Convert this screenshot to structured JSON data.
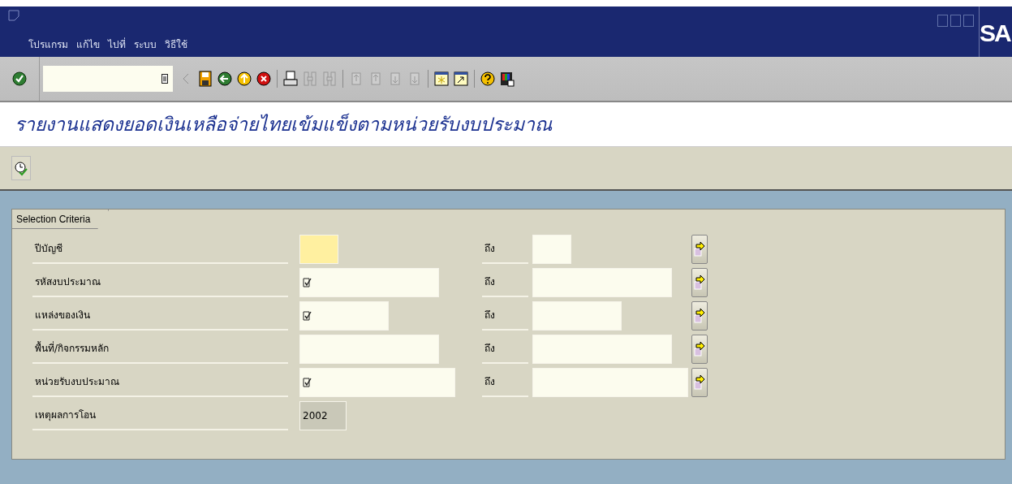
{
  "menu_bar": [
    "โปรแกรม",
    "แก้ไข",
    "ไปที่",
    "ระบบ",
    "วิธีใช้"
  ],
  "logo": "SA",
  "toolbar": [
    {
      "kind": "enter",
      "disabled": false
    },
    {
      "kind": "command-field"
    },
    {
      "kind": "back-arrow",
      "disabled": true
    },
    {
      "kind": "save",
      "disabled": false
    },
    {
      "kind": "back",
      "disabled": false
    },
    {
      "kind": "exit",
      "disabled": false
    },
    {
      "kind": "cancel",
      "disabled": false
    },
    {
      "kind": "print",
      "disabled": false
    },
    {
      "kind": "find",
      "disabled": true
    },
    {
      "kind": "find-next",
      "disabled": true
    },
    {
      "kind": "first-page",
      "disabled": true
    },
    {
      "kind": "previous-page",
      "disabled": true
    },
    {
      "kind": "next-page",
      "disabled": true
    },
    {
      "kind": "last-page",
      "disabled": true
    },
    {
      "kind": "new-session",
      "disabled": false
    },
    {
      "kind": "shortcut",
      "disabled": false
    },
    {
      "kind": "help",
      "disabled": false
    },
    {
      "kind": "layout",
      "disabled": false
    }
  ],
  "title": "รายงานแสดงยอดเงินเหลือจ่ายไทยเข้มแข็งตามหน่วยรับงบประมาณ",
  "group": {
    "title": "Selection Criteria",
    "rows": [
      {
        "kind": "range",
        "label": "ปีบัญชี",
        "focused": true,
        "multiple": false,
        "to_label": "ถึง"
      },
      {
        "kind": "range",
        "label": "รหัสงบประมาณ",
        "focused": false,
        "multiple": true,
        "to_label": "ถึง"
      },
      {
        "kind": "range",
        "label": "แหล่งของเงิน",
        "focused": false,
        "multiple": true,
        "to_label": "ถึง"
      },
      {
        "kind": "range",
        "label": "พื้นที่/กิจกรรมหลัก",
        "focused": false,
        "multiple": false,
        "to_label": "ถึง"
      },
      {
        "kind": "range",
        "label": "หน่วยรับงบประมาณ",
        "focused": false,
        "multiple": true,
        "to_label": "ถึง"
      },
      {
        "kind": "display",
        "label": "เหตุผลการโอน",
        "value": "2002"
      }
    ]
  }
}
